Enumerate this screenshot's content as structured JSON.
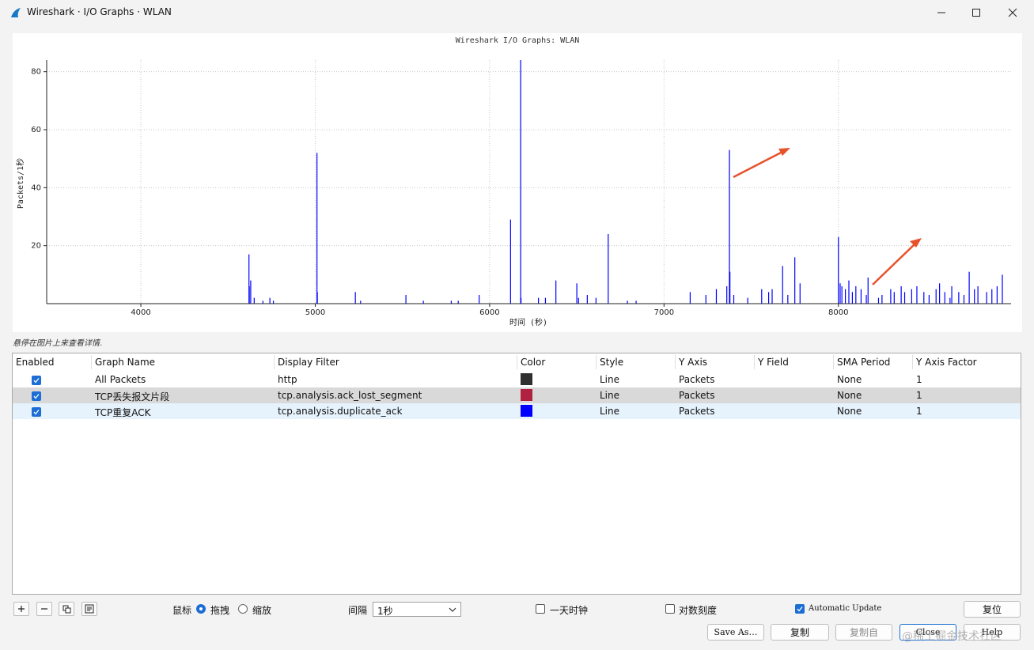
{
  "window": {
    "title": "Wireshark · I/O Graphs · WLAN",
    "controls": [
      "minimize",
      "maximize",
      "close"
    ]
  },
  "graph": {
    "title": "Wireshark I/O Graphs: WLAN",
    "hint": "悬停在图片上来查看详情.",
    "arrow_color": "#e8522a"
  },
  "chart_data": {
    "type": "bar",
    "title": "Wireshark I/O Graphs: WLAN",
    "xlabel": "时间 (秒)",
    "ylabel": "Packets/1秒",
    "xlim": [
      3460,
      8990
    ],
    "ylim": [
      0,
      84
    ],
    "xticks": [
      4000,
      5000,
      6000,
      7000,
      8000
    ],
    "yticks": [
      20,
      40,
      60,
      80
    ],
    "grid": true,
    "series": [
      {
        "name": "TCP重复ACK",
        "color": "#0000ff",
        "points": [
          [
            4620,
            17
          ],
          [
            4622,
            6
          ],
          [
            4630,
            8
          ],
          [
            4650,
            2
          ],
          [
            4700,
            1
          ],
          [
            4740,
            2
          ],
          [
            4760,
            1
          ],
          [
            5010,
            52
          ],
          [
            5012,
            4
          ],
          [
            5230,
            4
          ],
          [
            5260,
            1
          ],
          [
            5520,
            3
          ],
          [
            5620,
            1
          ],
          [
            5780,
            1
          ],
          [
            5820,
            1
          ],
          [
            5940,
            3
          ],
          [
            6120,
            29
          ],
          [
            6178,
            84
          ],
          [
            6180,
            2
          ],
          [
            6280,
            2
          ],
          [
            6320,
            2
          ],
          [
            6380,
            8
          ],
          [
            6500,
            7
          ],
          [
            6510,
            2
          ],
          [
            6560,
            3
          ],
          [
            6610,
            2
          ],
          [
            6680,
            24
          ],
          [
            6790,
            1
          ],
          [
            6840,
            1
          ],
          [
            7150,
            4
          ],
          [
            7240,
            3
          ],
          [
            7300,
            5
          ],
          [
            7360,
            6
          ],
          [
            7375,
            53
          ],
          [
            7378,
            11
          ],
          [
            7400,
            3
          ],
          [
            7480,
            2
          ],
          [
            7560,
            5
          ],
          [
            7600,
            4
          ],
          [
            7620,
            5
          ],
          [
            7680,
            13
          ],
          [
            7710,
            3
          ],
          [
            7750,
            16
          ],
          [
            7780,
            7
          ],
          [
            8000,
            23
          ],
          [
            8010,
            7
          ],
          [
            8020,
            6
          ],
          [
            8040,
            5
          ],
          [
            8060,
            8
          ],
          [
            8080,
            4
          ],
          [
            8100,
            6
          ],
          [
            8130,
            5
          ],
          [
            8160,
            3
          ],
          [
            8170,
            9
          ],
          [
            8230,
            2
          ],
          [
            8250,
            3
          ],
          [
            8300,
            5
          ],
          [
            8320,
            4
          ],
          [
            8360,
            6
          ],
          [
            8380,
            4
          ],
          [
            8420,
            5
          ],
          [
            8450,
            6
          ],
          [
            8490,
            4
          ],
          [
            8520,
            3
          ],
          [
            8560,
            5
          ],
          [
            8580,
            7
          ],
          [
            8610,
            4
          ],
          [
            8640,
            2
          ],
          [
            8650,
            6
          ],
          [
            8690,
            4
          ],
          [
            8720,
            3
          ],
          [
            8750,
            11
          ],
          [
            8780,
            5
          ],
          [
            8800,
            6
          ],
          [
            8850,
            4
          ],
          [
            8880,
            5
          ],
          [
            8910,
            6
          ],
          [
            8940,
            10
          ]
        ]
      }
    ]
  },
  "table": {
    "columns": [
      "Enabled",
      "Graph Name",
      "Display Filter",
      "Color",
      "Style",
      "Y Axis",
      "Y Field",
      "SMA Period",
      "Y Axis Factor"
    ],
    "rows": [
      {
        "enabled": true,
        "name": "All Packets",
        "filter": "http",
        "color": "#303030",
        "style": "Line",
        "y_axis": "Packets",
        "y_field": "",
        "sma": "None",
        "factor": "1"
      },
      {
        "enabled": true,
        "name": "TCP丢失报文片段",
        "filter": "tcp.analysis.ack_lost_segment",
        "color": "#b0213f",
        "style": "Line",
        "y_axis": "Packets",
        "y_field": "",
        "sma": "None",
        "factor": "1"
      },
      {
        "enabled": true,
        "name": "TCP重复ACK",
        "filter": "tcp.analysis.duplicate_ack",
        "color": "#0000ff",
        "style": "Line",
        "y_axis": "Packets",
        "y_field": "",
        "sma": "None",
        "factor": "1"
      }
    ]
  },
  "controls": {
    "mouse_label": "鼠标",
    "drag_label": "拖拽",
    "zoom_label": "缩放",
    "interval_label": "间隔",
    "interval_value": "1秒",
    "time_of_day_label": "一天时钟",
    "log_scale_label": "对数刻度",
    "auto_update_label": "Automatic Update",
    "reset_label": "复位",
    "save_as_label": "Save As…",
    "copy_label": "复制",
    "copy_from_label": "复制自",
    "close_label": "Close",
    "help_label": "Help"
  },
  "watermark": "@稀土掘金技术社区"
}
